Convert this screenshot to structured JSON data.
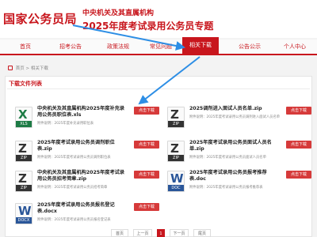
{
  "header": {
    "logo": "国家公务员局",
    "subtitle": "中央机关及其直属机构",
    "title": "2025年度考试录用公务员专题"
  },
  "nav": {
    "items": [
      "首页",
      "招考公告",
      "政策法规",
      "常见问题",
      "相关下载",
      "公告公示",
      "个人中心"
    ],
    "active_index": 4
  },
  "breadcrumb": {
    "home": "首页",
    "sep": ">",
    "current": "相关下载"
  },
  "panel": {
    "title": "下载文件列表"
  },
  "files": [
    {
      "icon": "xls",
      "mark": "X",
      "tag": "XLS",
      "name": "中央机关及其直属机构2025年度补充录用公务员职位表.xls",
      "meta": "附件说明：2025年度补充录用职位表",
      "button": "点击下载"
    },
    {
      "icon": "zip",
      "mark": "Z",
      "tag": "ZIP",
      "name": "2025调剂进入面试人员名单.zip",
      "meta": "附件说明：2025年度考试录用公务员调剂进入面试人员名单",
      "button": "点击下载"
    },
    {
      "icon": "zip",
      "mark": "Z",
      "tag": "ZIP",
      "name": "2025年度考试录用公务员调剂职位表.zip",
      "meta": "附件说明：2025年度考试录用公务员调剂职位表",
      "button": "点击下载"
    },
    {
      "icon": "zip",
      "mark": "Z",
      "tag": "ZIP",
      "name": "2025年度考试录用公务员面试人员名单.zip",
      "meta": "附件说明：2025年度考试录用公务员面试人员名单",
      "button": "点击下载"
    },
    {
      "icon": "zip",
      "mark": "Z",
      "tag": "ZIP",
      "name": "中央机关及其直属机构2025年度考试录用公务员招考简章.zip",
      "meta": "附件说明：2025年度考试录用公务员招考简章",
      "button": "点击下载"
    },
    {
      "icon": "doc",
      "mark": "W",
      "tag": "DOC",
      "name": "2025年度考试录用公务员报考推荐表.doc",
      "meta": "附件说明：2025年度考试录用公务员报考推荐表",
      "button": "点击下载"
    },
    {
      "icon": "doc",
      "mark": "W",
      "tag": "DOCX",
      "name": "2025年度考试录用公务员报名登记表.docx",
      "meta": "附件说明：2025年度考试录用公务员报名登记表",
      "button": "点击下载"
    }
  ],
  "pagination": {
    "first": "首页",
    "prev": "上一页",
    "current": "1",
    "next": "下一页",
    "last": "尾页"
  },
  "colors": {
    "accent": "#c8161d",
    "download_button": "#d63a3a",
    "arrow": "#2d8ee5"
  }
}
